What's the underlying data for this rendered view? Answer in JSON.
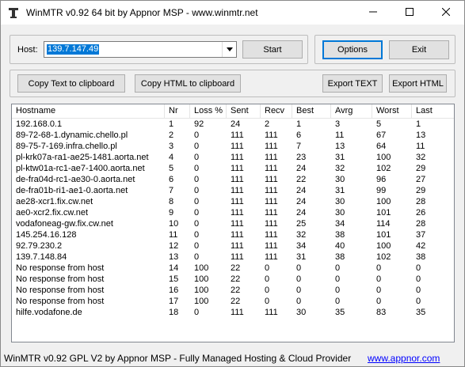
{
  "window": {
    "title": "WinMTR v0.92 64 bit by Appnor MSP - www.winmtr.net"
  },
  "host": {
    "label": "Host:",
    "value": "139.7.147.49"
  },
  "buttons": {
    "start": "Start",
    "options": "Options",
    "exit": "Exit",
    "copy_text": "Copy Text to clipboard",
    "copy_html": "Copy HTML to clipboard",
    "export_text": "Export TEXT",
    "export_html": "Export HTML"
  },
  "table": {
    "columns": [
      "Hostname",
      "Nr",
      "Loss %",
      "Sent",
      "Recv",
      "Best",
      "Avrg",
      "Worst",
      "Last"
    ],
    "rows": [
      [
        "192.168.0.1",
        "1",
        "92",
        "24",
        "2",
        "1",
        "3",
        "5",
        "1"
      ],
      [
        "89-72-68-1.dynamic.chello.pl",
        "2",
        "0",
        "111",
        "111",
        "6",
        "11",
        "67",
        "13"
      ],
      [
        "89-75-7-169.infra.chello.pl",
        "3",
        "0",
        "111",
        "111",
        "7",
        "13",
        "64",
        "11"
      ],
      [
        "pl-krk07a-ra1-ae25-1481.aorta.net",
        "4",
        "0",
        "111",
        "111",
        "23",
        "31",
        "100",
        "32"
      ],
      [
        "pl-ktw01a-rc1-ae7-1400.aorta.net",
        "5",
        "0",
        "111",
        "111",
        "24",
        "32",
        "102",
        "29"
      ],
      [
        "de-fra04d-rc1-ae30-0.aorta.net",
        "6",
        "0",
        "111",
        "111",
        "22",
        "30",
        "96",
        "27"
      ],
      [
        "de-fra01b-ri1-ae1-0.aorta.net",
        "7",
        "0",
        "111",
        "111",
        "24",
        "31",
        "99",
        "29"
      ],
      [
        "ae28-xcr1.fix.cw.net",
        "8",
        "0",
        "111",
        "111",
        "24",
        "30",
        "100",
        "28"
      ],
      [
        "ae0-xcr2.fix.cw.net",
        "9",
        "0",
        "111",
        "111",
        "24",
        "30",
        "101",
        "26"
      ],
      [
        "vodafoneag-gw.fix.cw.net",
        "10",
        "0",
        "111",
        "111",
        "25",
        "34",
        "114",
        "28"
      ],
      [
        "145.254.16.128",
        "11",
        "0",
        "111",
        "111",
        "32",
        "38",
        "101",
        "37"
      ],
      [
        "92.79.230.2",
        "12",
        "0",
        "111",
        "111",
        "34",
        "40",
        "100",
        "42"
      ],
      [
        "139.7.148.84",
        "13",
        "0",
        "111",
        "111",
        "31",
        "38",
        "102",
        "38"
      ],
      [
        "No response from host",
        "14",
        "100",
        "22",
        "0",
        "0",
        "0",
        "0",
        "0"
      ],
      [
        "No response from host",
        "15",
        "100",
        "22",
        "0",
        "0",
        "0",
        "0",
        "0"
      ],
      [
        "No response from host",
        "16",
        "100",
        "22",
        "0",
        "0",
        "0",
        "0",
        "0"
      ],
      [
        "No response from host",
        "17",
        "100",
        "22",
        "0",
        "0",
        "0",
        "0",
        "0"
      ],
      [
        "hilfe.vodafone.de",
        "18",
        "0",
        "111",
        "111",
        "30",
        "35",
        "83",
        "35"
      ]
    ]
  },
  "status": {
    "text": "WinMTR v0.92 GPL V2 by Appnor MSP - Fully Managed Hosting & Cloud Provider",
    "link": "www.appnor.com"
  },
  "icons": [
    "app-icon",
    "minimize-icon",
    "maximize-icon",
    "close-icon",
    "dropdown-arrow-icon"
  ],
  "colors": {
    "selection": "#0078d7",
    "link": "#0000ff",
    "default_button_border": "#0078d7"
  }
}
